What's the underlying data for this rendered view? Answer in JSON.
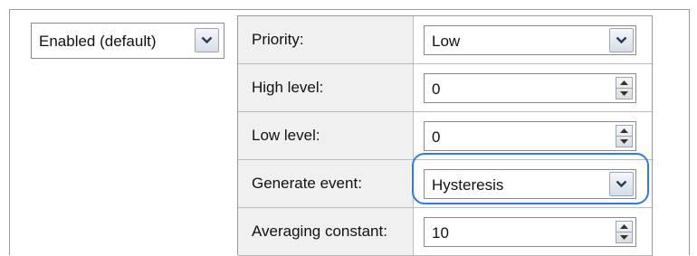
{
  "status_select": {
    "value": "Enabled (default)"
  },
  "rows": [
    {
      "label": "Priority:",
      "value": "Low",
      "control": "dropdown"
    },
    {
      "label": "High level:",
      "value": "0",
      "control": "spinner"
    },
    {
      "label": "Low level:",
      "value": "0",
      "control": "spinner"
    },
    {
      "label": "Generate event:",
      "value": "Hysteresis",
      "control": "dropdown",
      "highlighted": true
    },
    {
      "label": "Averaging constant:",
      "value": "10",
      "control": "spinner"
    }
  ],
  "colors": {
    "highlight": "#2e7be4",
    "label_background": "#f0f0f0",
    "border": "#9a9a9a"
  }
}
